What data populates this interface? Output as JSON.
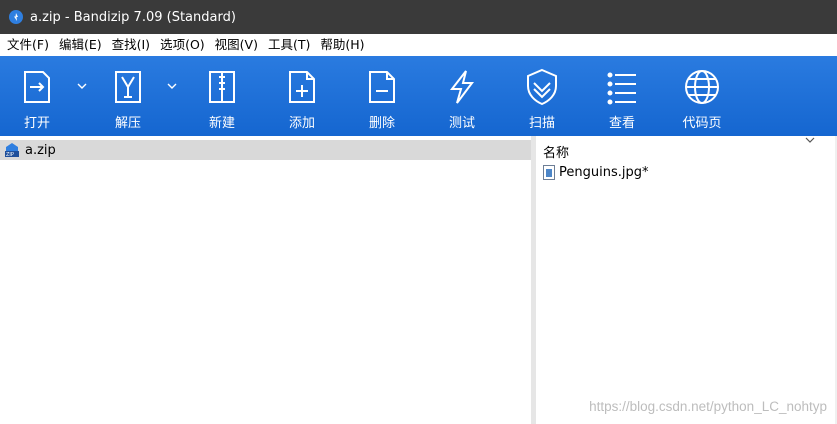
{
  "window": {
    "title": "a.zip - Bandizip 7.09 (Standard)"
  },
  "menu": [
    {
      "label": "文件(F)"
    },
    {
      "label": "编辑(E)"
    },
    {
      "label": "查找(I)"
    },
    {
      "label": "选项(O)"
    },
    {
      "label": "视图(V)"
    },
    {
      "label": "工具(T)"
    },
    {
      "label": "帮助(H)"
    }
  ],
  "toolbar": {
    "open": "打开",
    "extract": "解压",
    "new": "新建",
    "add": "添加",
    "delete": "删除",
    "test": "测试",
    "scan": "扫描",
    "view": "查看",
    "codepage": "代码页"
  },
  "tree": {
    "root_label": "a.zip"
  },
  "filelist": {
    "column_name": "名称",
    "files": [
      {
        "name": "Penguins.jpg*"
      }
    ]
  },
  "watermark": "https://blog.csdn.net/python_LC_nohtyp",
  "colors": {
    "toolbar": "#1e70d8",
    "titlebar": "#3a3a3a",
    "selection": "#d9d9d9"
  }
}
